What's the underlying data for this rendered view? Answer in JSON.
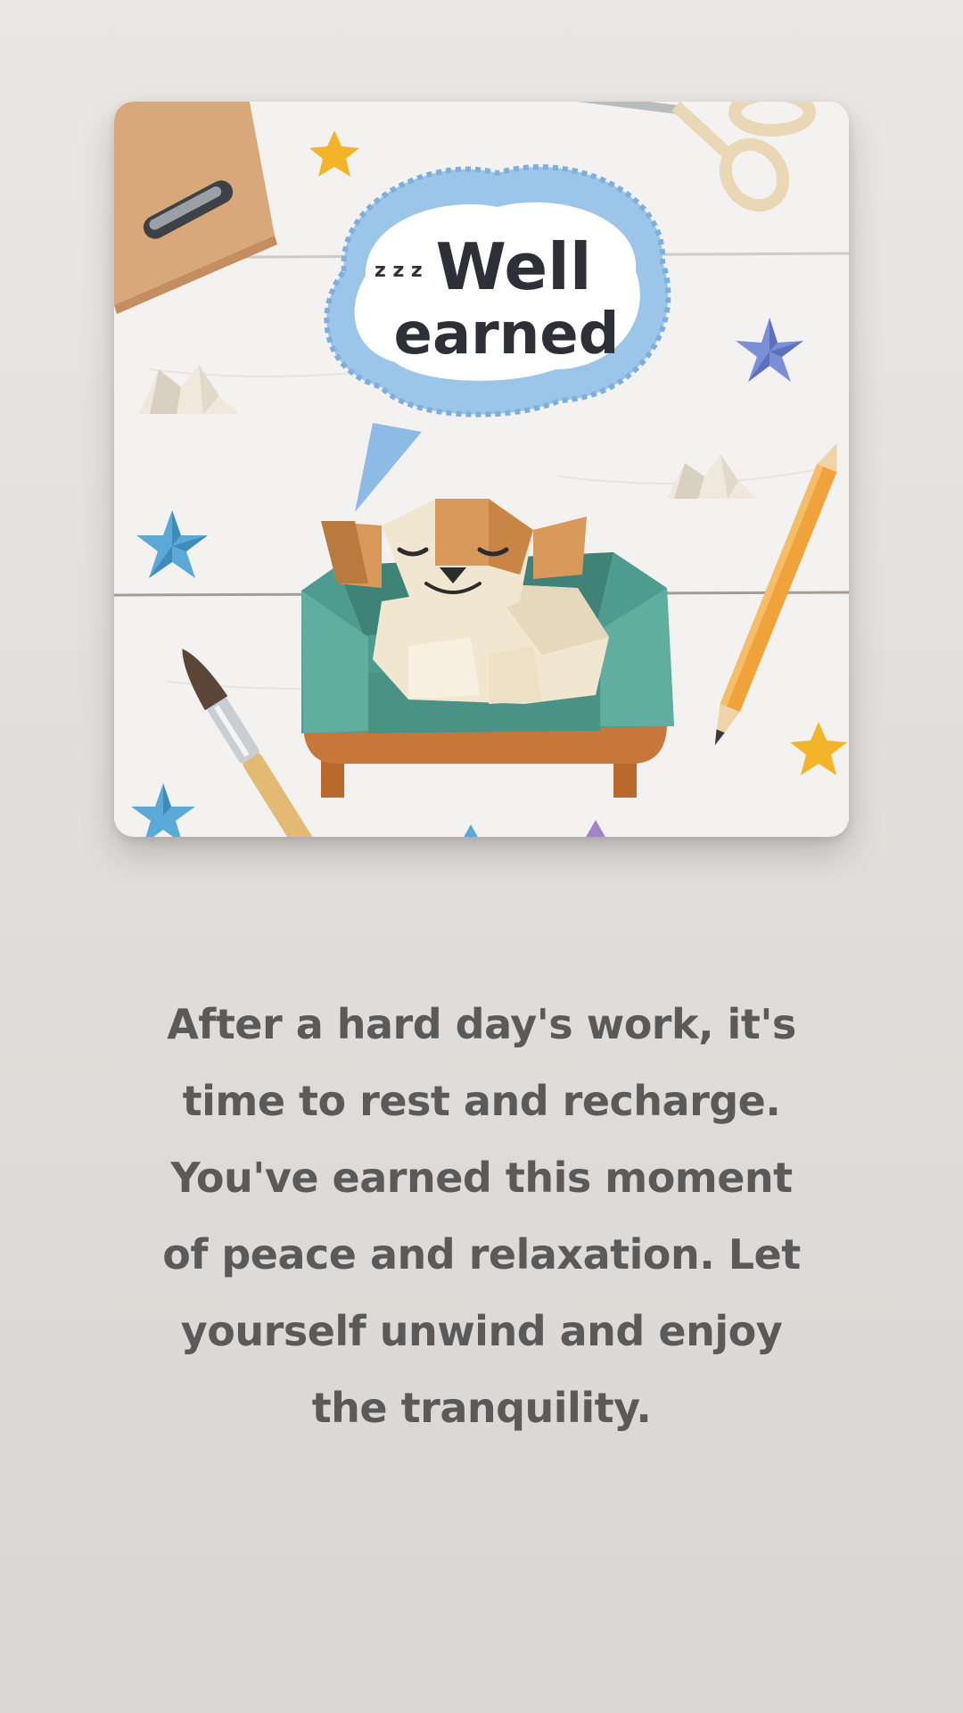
{
  "illustration": {
    "bubble_line1": "Well",
    "bubble_line2": "earned",
    "zzz": "z z z",
    "colors": {
      "board": "#f3f2f0",
      "bubble_frill": "#9cc5ea",
      "sofa": "#4e9b8f",
      "dog_light": "#f1e7d1",
      "dog_orange": "#d9995a",
      "pencil": "#f0a23b",
      "clipboard": "#d8a77a",
      "star_gold": "#f3b42a",
      "star_blue": "#5aa9d6"
    }
  },
  "message": {
    "text": "After a hard day's work, it's time to rest and recharge. You've earned this moment of peace and relaxation. Let yourself unwind and enjoy the tranquility."
  }
}
